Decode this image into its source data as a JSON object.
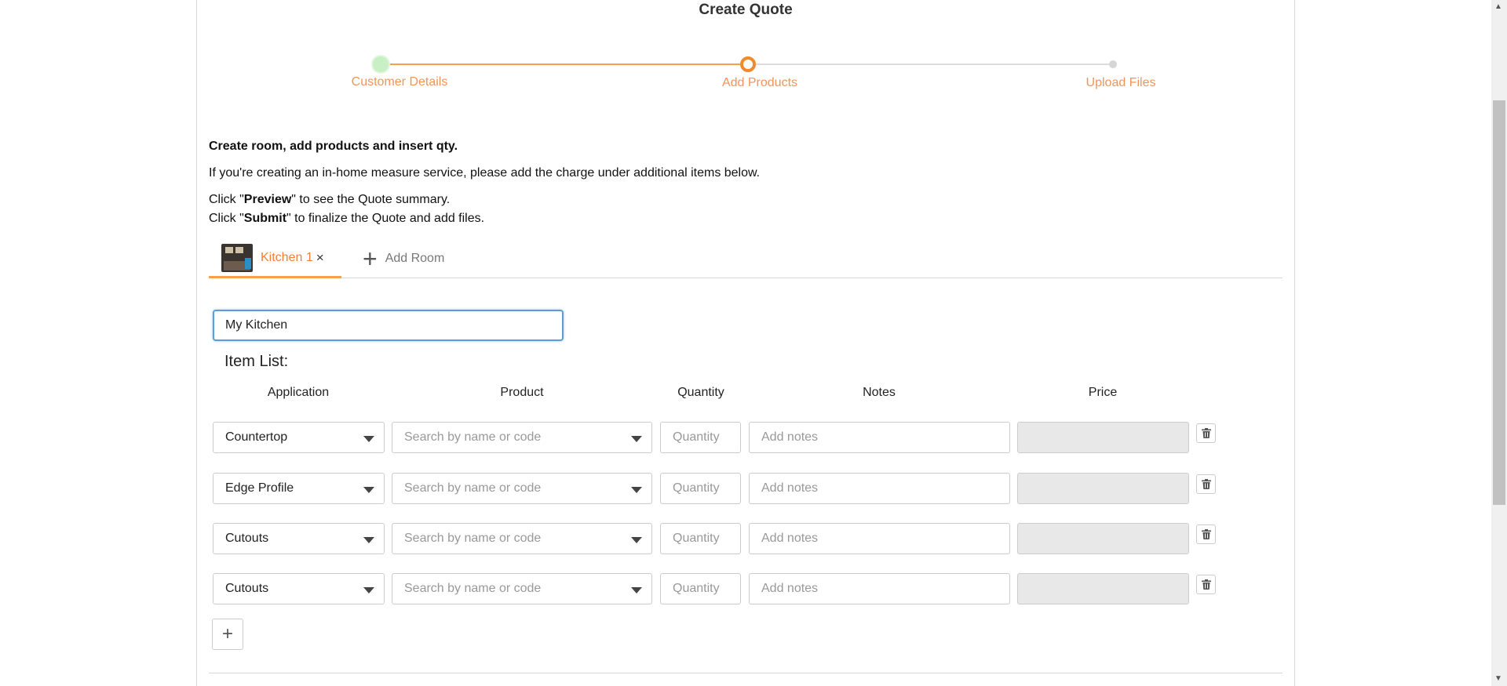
{
  "title": "Create Quote",
  "stepper": {
    "steps": [
      {
        "label": "Customer Details",
        "state": "complete"
      },
      {
        "label": "Add Products",
        "state": "current"
      },
      {
        "label": "Upload Files",
        "state": "upcoming"
      }
    ],
    "accent_color": "#f5a04f",
    "complete_color": "#c9efc4"
  },
  "instructions": {
    "heading": "Create room, add products and insert qty.",
    "line1": "If you're creating an in-home measure service, please add the charge under additional items below.",
    "preview_prefix": "Click \"",
    "preview_bold": "Preview",
    "preview_suffix": "\" to see the Quote summary.",
    "submit_prefix": "Click \"",
    "submit_bold": "Submit",
    "submit_suffix": "\" to finalize the Quote and add files."
  },
  "tabs": {
    "room_label": "Kitchen 1",
    "close_glyph": "×",
    "add_room_glyph": "+",
    "add_room_label": "Add Room"
  },
  "room_name_value": "My Kitchen",
  "item_list_label": "Item List:",
  "columns": {
    "application": "Application",
    "product": "Product",
    "quantity": "Quantity",
    "notes": "Notes",
    "price": "Price"
  },
  "rows": [
    {
      "application": "Countertop",
      "product_placeholder": "Search by name or code",
      "quantity_placeholder": "Quantity",
      "notes_placeholder": "Add notes"
    },
    {
      "application": "Edge Profile",
      "product_placeholder": "Search by name or code",
      "quantity_placeholder": "Quantity",
      "notes_placeholder": "Add notes"
    },
    {
      "application": "Cutouts",
      "product_placeholder": "Search by name or code",
      "quantity_placeholder": "Quantity",
      "notes_placeholder": "Add notes"
    },
    {
      "application": "Cutouts",
      "product_placeholder": "Search by name or code",
      "quantity_placeholder": "Quantity",
      "notes_placeholder": "Add notes"
    }
  ],
  "add_row_glyph": "+",
  "icons": {
    "trash": "trash-icon",
    "caret": "chevron-down-icon"
  }
}
